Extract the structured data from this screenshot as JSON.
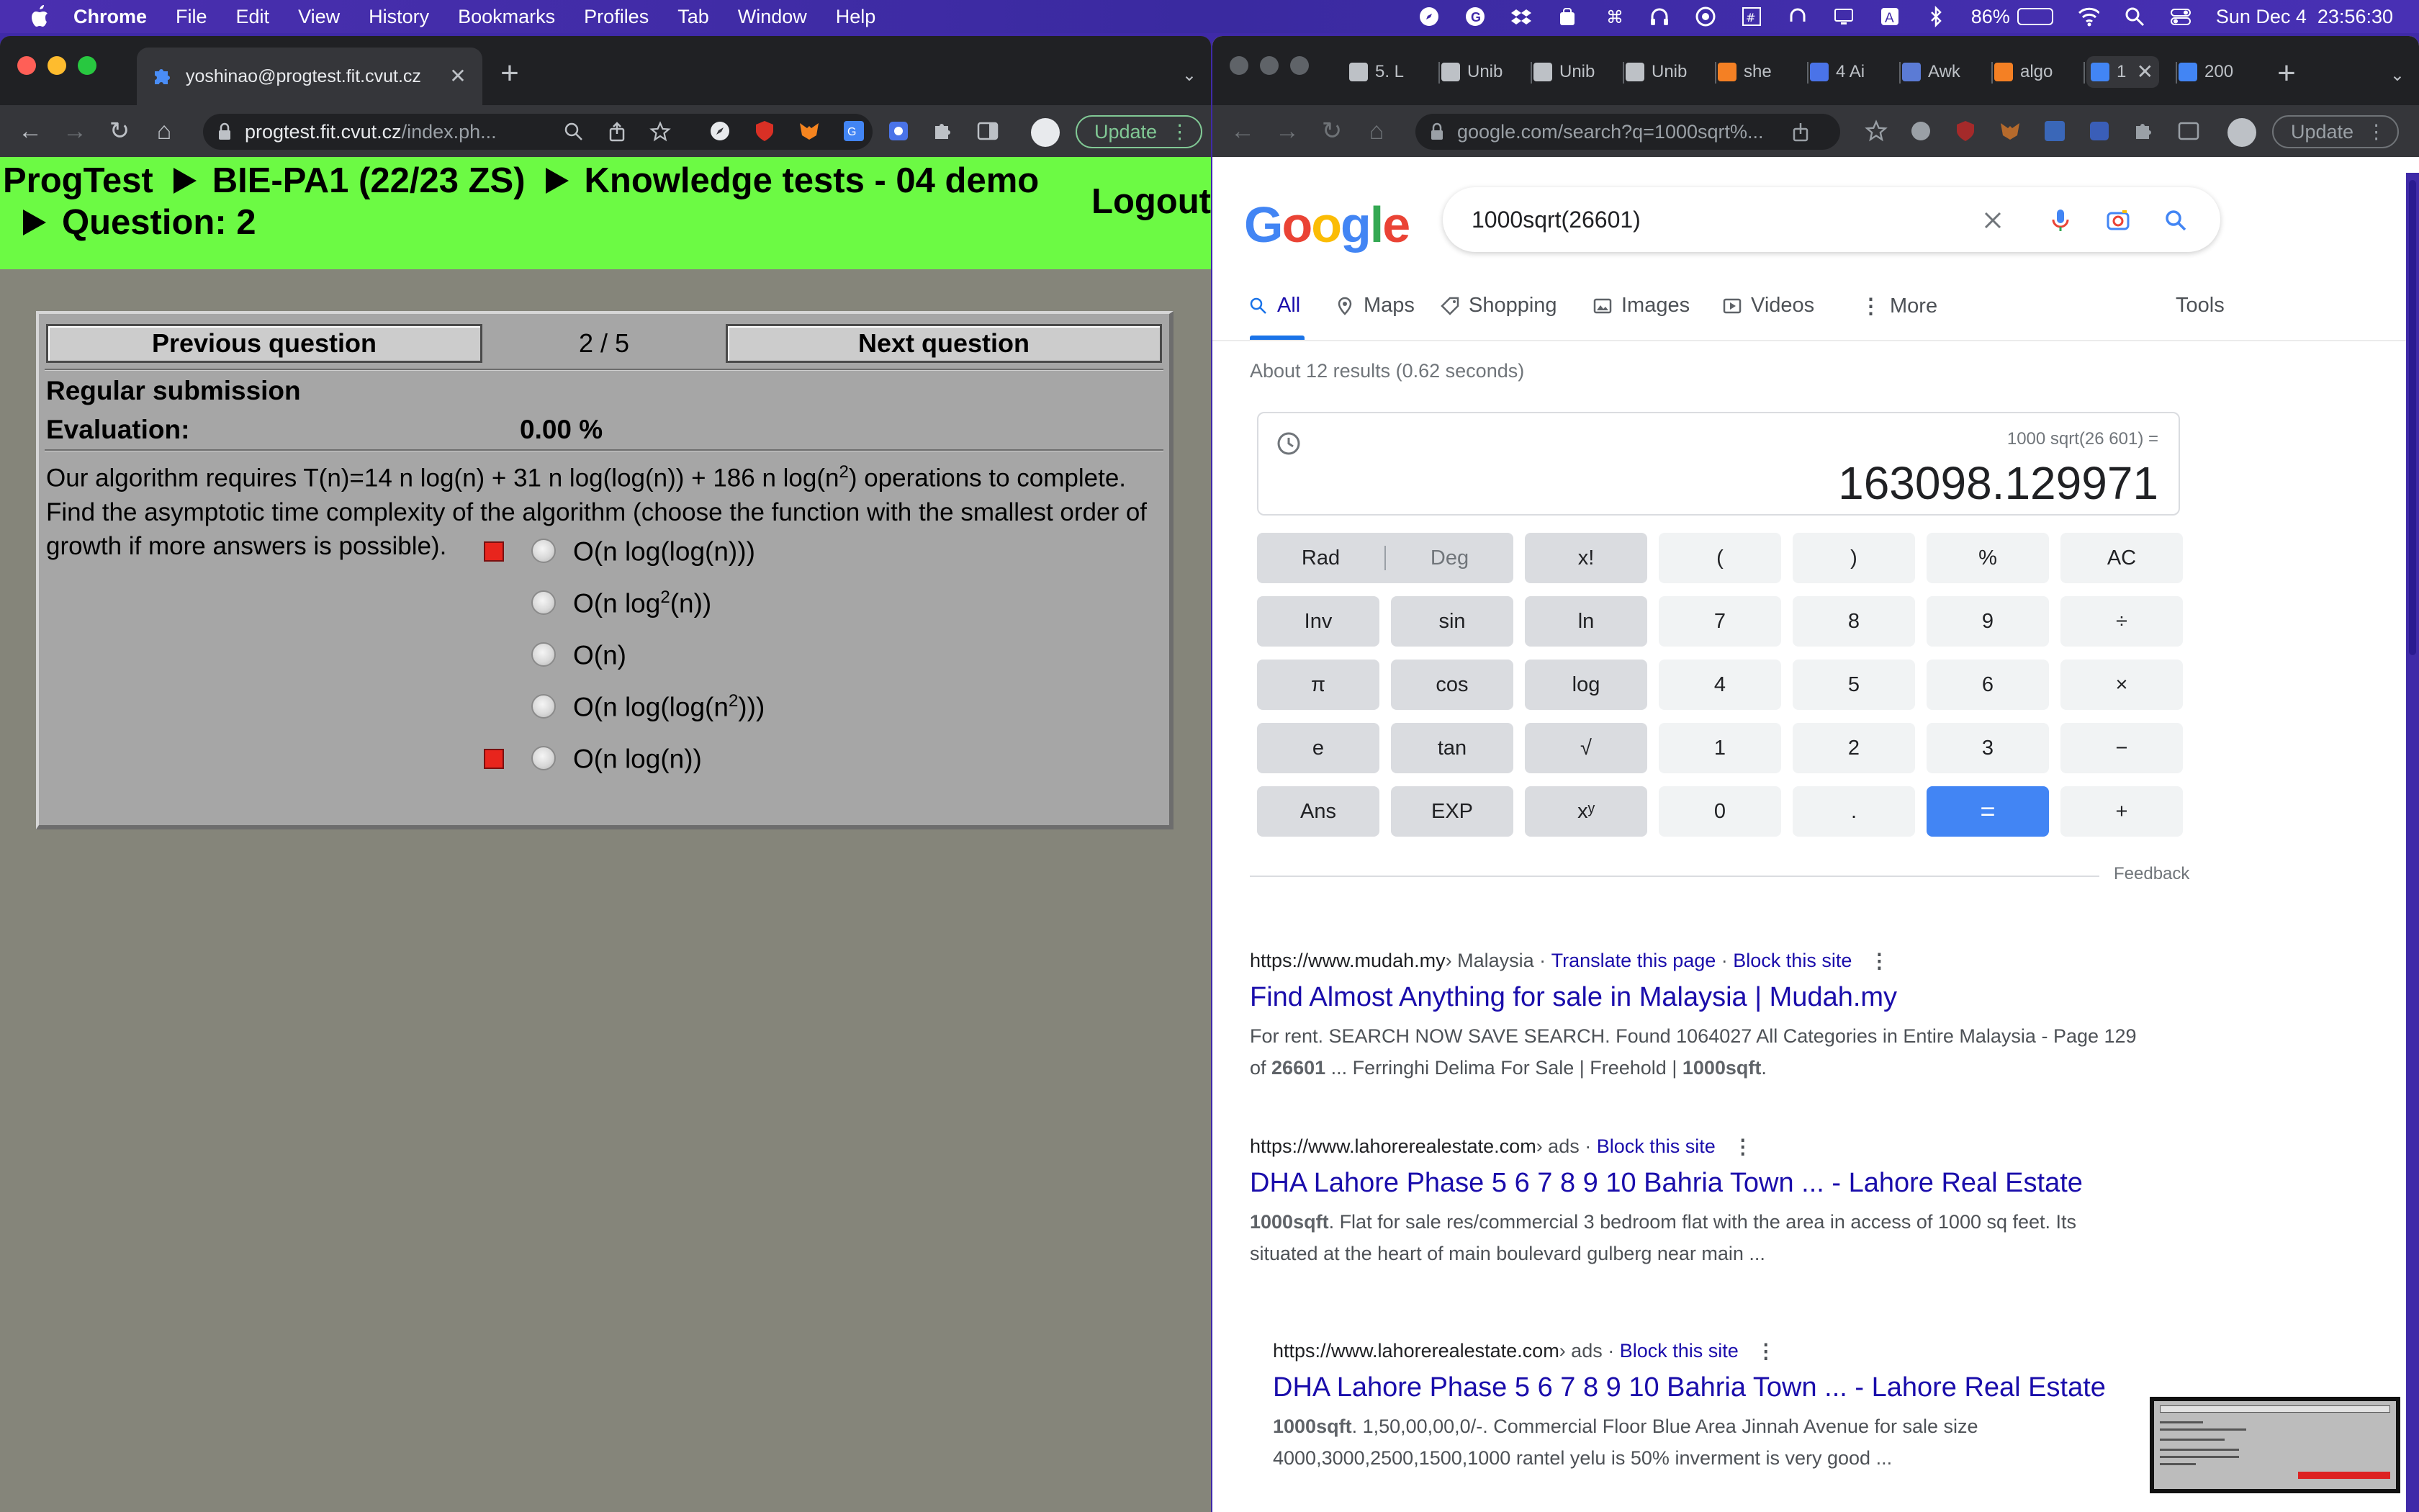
{
  "menubar": {
    "app_name": "Chrome",
    "menus": [
      "File",
      "Edit",
      "View",
      "History",
      "Bookmarks",
      "Profiles",
      "Tab",
      "Window",
      "Help"
    ],
    "battery_percent": "86%",
    "battery_level": 0.86,
    "clock": "Sun Dec 4  23:56:30"
  },
  "left_window": {
    "tab_title": "yoshinao@progtest.fit.cvut.cz",
    "url_host": "progtest.fit.cvut.cz",
    "url_path": "/index.ph...",
    "update_label": "Update",
    "page": {
      "breadcrumb": [
        "ProgTest",
        "BIE-PA1 (22/23 ZS)",
        "Knowledge tests - 04 demo",
        "Question: 2"
      ],
      "logout": "Logout",
      "prev_button": "Previous question",
      "next_button": "Next question",
      "counter": "2 / 5",
      "submission_label": "Regular submission",
      "evaluation_label": "Evaluation:",
      "evaluation_value": "0.00 %",
      "question": {
        "part1": "Our algorithm requires T(n)=14 n log(n) + 31 n log(log(n)) + 186 n log(n",
        "sup": "2",
        "part2": ") operations to complete. Find the asymptotic time complexity of the algorithm (choose the function with the smallest order of growth if more answers is possible)."
      },
      "options": [
        {
          "pre": "O(n log(log(n)))",
          "sup": "",
          "post": "",
          "marked": true
        },
        {
          "pre": "O(n log",
          "sup": "2",
          "post": "(n))",
          "marked": false
        },
        {
          "pre": "O(n)",
          "sup": "",
          "post": "",
          "marked": false
        },
        {
          "pre": "O(n log(log(n",
          "sup": "2",
          "post": ")))",
          "marked": false
        },
        {
          "pre": "O(n log(n))",
          "sup": "",
          "post": "",
          "marked": true
        }
      ]
    }
  },
  "right_window": {
    "tabs": [
      {
        "title": "5. L",
        "icon": "document-icon"
      },
      {
        "title": "Unib",
        "icon": "document-icon"
      },
      {
        "title": "Unib",
        "icon": "document-icon"
      },
      {
        "title": "Unib",
        "icon": "document-icon"
      },
      {
        "title": "she",
        "icon": "stackoverflow-icon"
      },
      {
        "title": "4 Ai",
        "icon": "grid-icon"
      },
      {
        "title": "Awk",
        "icon": "awk-icon"
      },
      {
        "title": "algo",
        "icon": "stackoverflow-icon"
      },
      {
        "title": "1",
        "icon": "google-icon"
      },
      {
        "title": "200",
        "icon": "google-icon"
      }
    ],
    "url_host": "google.com",
    "url_path": "/search?q=1000sqrt%...",
    "update_label": "Update",
    "search_query": "1000sqrt(26601)",
    "nav_tabs": [
      "All",
      "Maps",
      "Shopping",
      "Images",
      "Videos",
      "More"
    ],
    "tools_label": "Tools",
    "result_stats": "About 12 results (0.62 seconds)",
    "calculator": {
      "expression": "1000 sqrt(26 601) =",
      "result": "163098.129971",
      "rows": [
        [
          "Rad",
          "Deg",
          "x!",
          "(",
          ")",
          "%",
          "AC"
        ],
        [
          "Inv",
          "sin",
          "ln",
          "7",
          "8",
          "9",
          "÷"
        ],
        [
          "π",
          "cos",
          "log",
          "4",
          "5",
          "6",
          "×"
        ],
        [
          "e",
          "tan",
          "√",
          "1",
          "2",
          "3",
          "−"
        ],
        [
          "Ans",
          "EXP",
          "xʸ",
          "0",
          ".",
          "=",
          "+"
        ]
      ]
    },
    "feedback": "Feedback",
    "results": [
      {
        "url": "https://www.mudah.my",
        "crumb": " › Malaysia",
        "links": [
          "Translate this page",
          "Block this site"
        ],
        "title": "Find Almost Anything for sale in Malaysia | Mudah.my",
        "snippet_html": "For rent. SEARCH NOW SAVE SEARCH. Found 1064027 All Categories in Entire Malaysia - Page 129 of <b>26601</b> ... Ferringhi Delima For Sale | Freehold | <b>1000sqft</b>."
      },
      {
        "url": "https://www.lahorerealestate.com",
        "crumb": " › ads",
        "links": [
          "Block this site"
        ],
        "title": "DHA Lahore Phase 5 6 7 8 9 10 Bahria Town ... - Lahore Real Estate",
        "snippet_html": "<b>1000sqft</b>. Flat for sale res/commercial 3 bedroom flat with the area in access of 1000 sq feet. Its situated at the heart of main boulevard gulberg near main ..."
      },
      {
        "url": "https://www.lahorerealestate.com",
        "crumb": " › ads",
        "links": [
          "Block this site"
        ],
        "title": "DHA Lahore Phase 5 6 7 8 9 10 Bahria Town ... - Lahore Real Estate",
        "snippet_html": "<b>1000sqft</b>. 1,50,00,00,0/-. Commercial Floor Blue Area Jinnah Avenue for sale size 4000,3000,2500,1500,1000 rantel yelu is 50% inverment is very good ..."
      }
    ]
  },
  "pip": {
    "prev": "Previous question",
    "counter": "1 / 1",
    "next": "Next question",
    "submission": "Regular submission",
    "evaluation": "Evaluation:",
    "eval_value": "0.00 %",
    "question": "How many times is foo() called?",
    "code": [
      "for ( i = 0; i < 2 * 86; i ++ )",
      "  for ( j = 0; j < i; j ++ )",
      "    foo ( );"
    ],
    "answer_label": "Answer (decimal integer number):"
  },
  "colors": {
    "progtest_header": "#6cfa44",
    "progtest_bg": "#85857a",
    "mark_red": "#e8251d",
    "google_blue": "#1a73e8",
    "link_blue": "#1a0dab"
  }
}
